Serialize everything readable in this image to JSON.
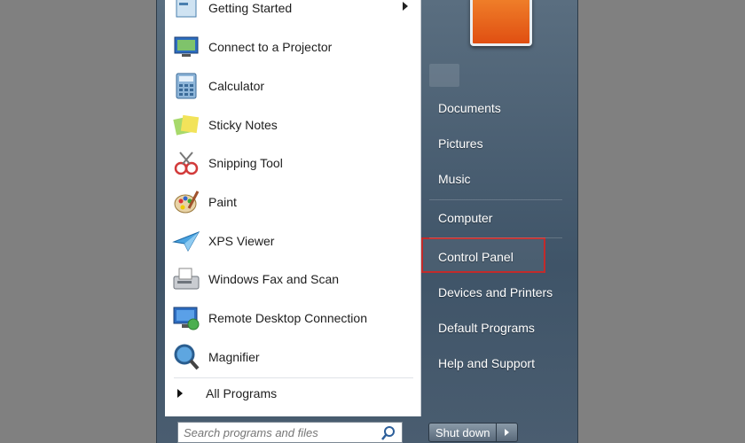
{
  "programs": [
    {
      "label": "Getting Started",
      "icon": "getting-started-icon",
      "has_submenu": true
    },
    {
      "label": "Connect to a Projector",
      "icon": "projector-icon"
    },
    {
      "label": "Calculator",
      "icon": "calculator-icon"
    },
    {
      "label": "Sticky Notes",
      "icon": "sticky-notes-icon"
    },
    {
      "label": "Snipping Tool",
      "icon": "scissors-icon"
    },
    {
      "label": "Paint",
      "icon": "paint-palette-icon"
    },
    {
      "label": "XPS Viewer",
      "icon": "paper-plane-icon"
    },
    {
      "label": "Windows Fax and Scan",
      "icon": "fax-icon"
    },
    {
      "label": "Remote Desktop Connection",
      "icon": "remote-desktop-icon"
    },
    {
      "label": "Magnifier",
      "icon": "magnifier-icon"
    }
  ],
  "all_programs": "All Programs",
  "search": {
    "placeholder": "Search programs and files"
  },
  "right_pane": {
    "links": [
      "Documents",
      "Pictures",
      "Music",
      "Computer",
      "Control Panel",
      "Devices and Printers",
      "Default Programs",
      "Help and Support"
    ],
    "highlighted": "Control Panel",
    "highlight_color": "#c22b2b"
  },
  "shutdown": {
    "label": "Shut down"
  }
}
